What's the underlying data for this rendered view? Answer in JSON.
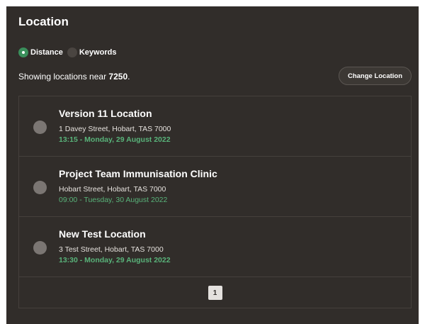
{
  "header": {
    "title": "Location"
  },
  "search_mode": {
    "options": [
      {
        "label": "Distance",
        "selected": true
      },
      {
        "label": "Keywords",
        "selected": false
      }
    ]
  },
  "status": {
    "prefix": "Showing locations near ",
    "postcode": "7250",
    "suffix": "."
  },
  "change_location_label": "Change Location",
  "locations": [
    {
      "name": "Version 11 Location",
      "address": "1 Davey Street, Hobart, TAS 7000",
      "time": "13:15 - Monday, 29 August 2022"
    },
    {
      "name": "Project Team Immunisation Clinic",
      "address": "Hobart Street, Hobart, TAS 7000",
      "time": "09:00 - Tuesday, 30 August 2022"
    },
    {
      "name": "New Test Location",
      "address": "3 Test Street, Hobart, TAS 7000",
      "time": "13:30 - Monday, 29 August 2022"
    }
  ],
  "pagination": {
    "current_page": "1"
  },
  "colors": {
    "panel_bg": "#312d2a",
    "accent_green": "#59b37a",
    "radio_selected": "#3a8f5b"
  }
}
